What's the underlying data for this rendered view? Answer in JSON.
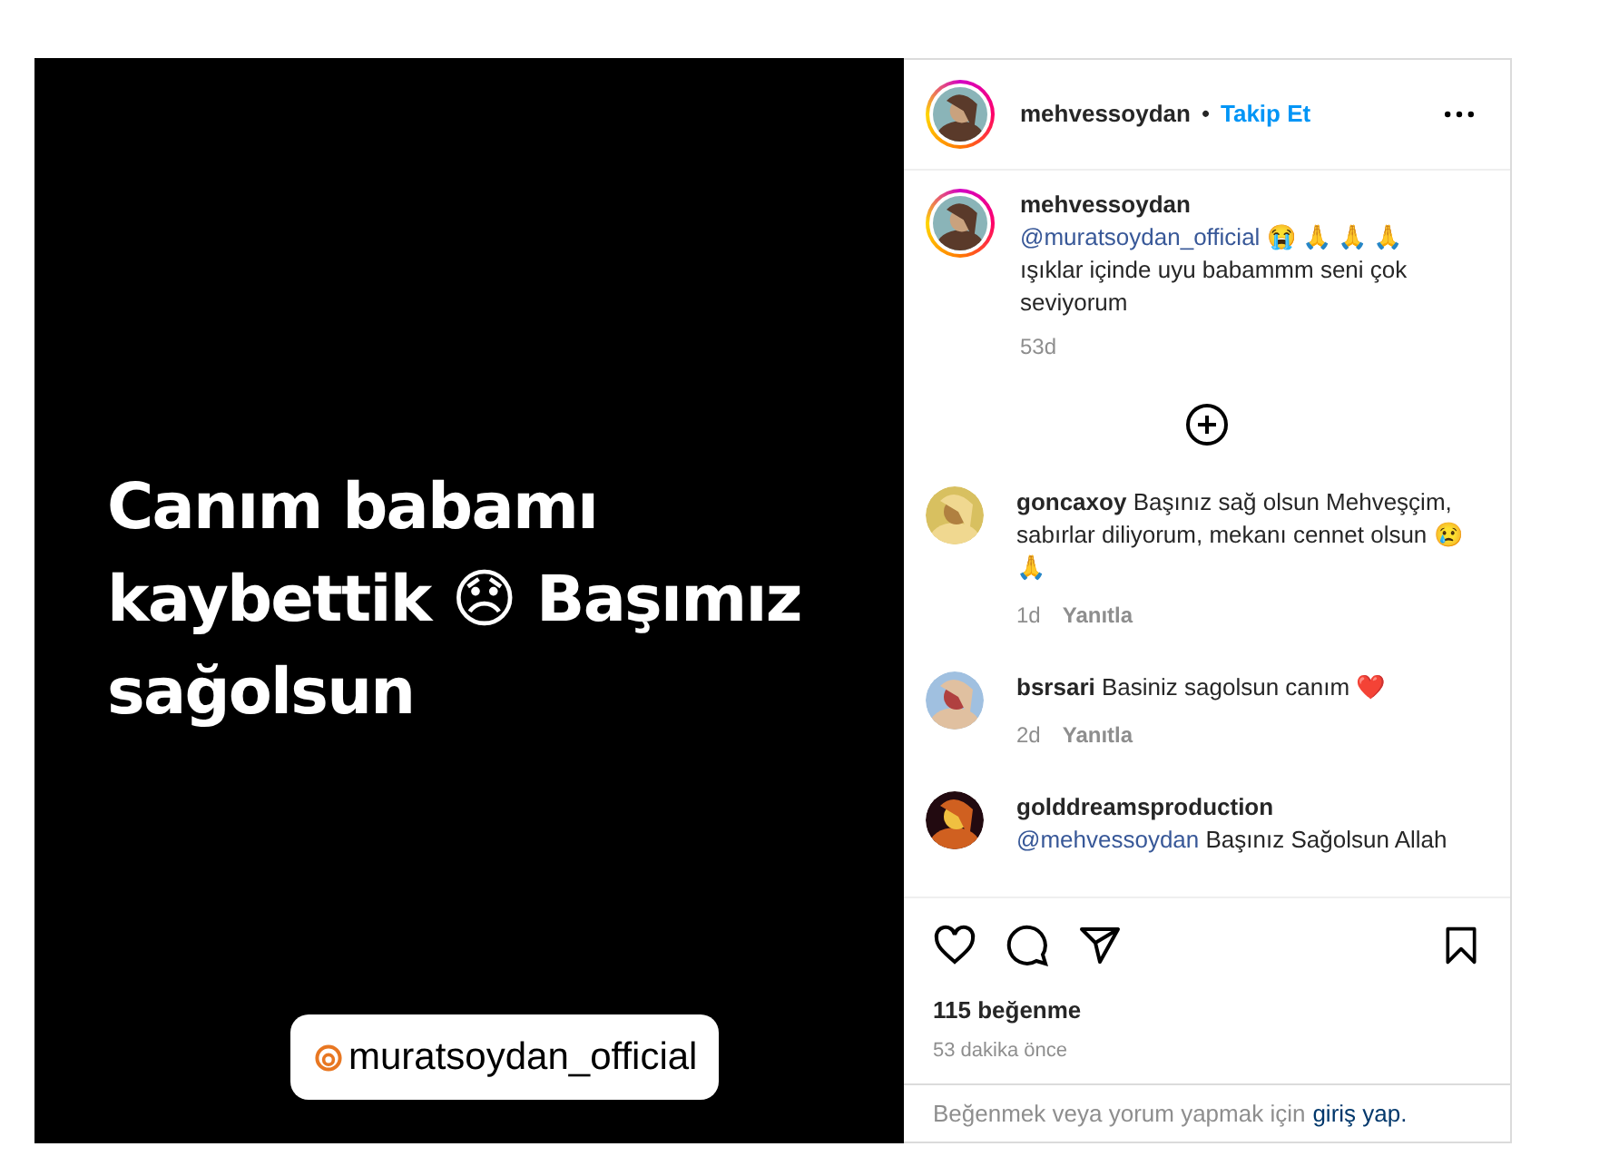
{
  "post_image": {
    "headline": "Canım babamı kaybettik 😞 Başımız sağolsun",
    "tag": "muratsoydan_official"
  },
  "header": {
    "username": "mehvessoydan",
    "separator": "•",
    "follow": "Takip Et"
  },
  "caption": {
    "username": "mehvessoydan",
    "mention": "@muratsoydan_official",
    "emojis": "😭 🙏 🙏 🙏",
    "text": "ışıklar içinde uyu babammm seni çok seviyorum",
    "time": "53d"
  },
  "comments": [
    {
      "username": "goncaxoy",
      "text": "Başınız sağ olsun Mehveşçim, sabırlar diliyorum, mekanı cennet olsun 😢 🙏",
      "time": "1d",
      "reply": "Yanıtla"
    },
    {
      "username": "bsrsari",
      "text": "Basiniz sagolsun canım ❤️",
      "time": "2d",
      "reply": "Yanıtla"
    },
    {
      "username": "golddreamsproduction",
      "mention": "@mehvessoydan",
      "text": "Başınız Sağolsun Allah"
    }
  ],
  "likes": "115 beğenme",
  "posted": "53 dakika önce",
  "login": {
    "text": "Beğenmek veya yorum yapmak için",
    "link": "giriş yap."
  }
}
